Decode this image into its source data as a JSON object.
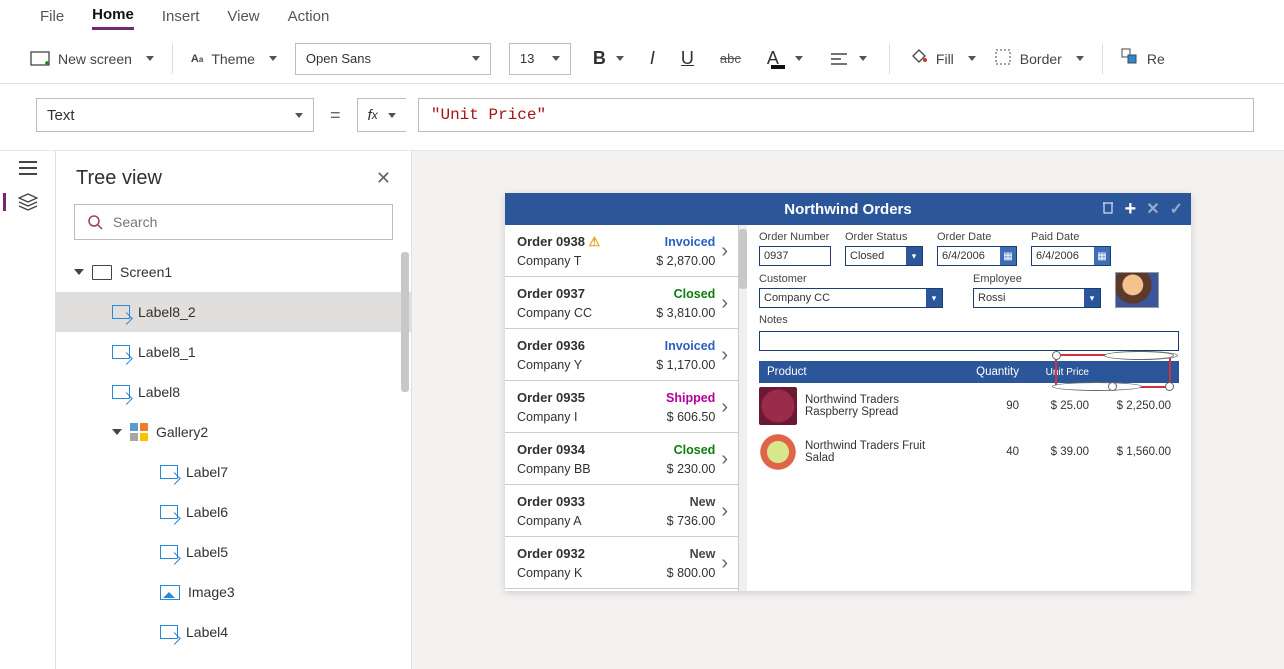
{
  "menu": {
    "file": "File",
    "home": "Home",
    "insert": "Insert",
    "view": "View",
    "action": "Action"
  },
  "ribbon": {
    "new_screen": "New screen",
    "theme": "Theme",
    "font": "Open Sans",
    "size": "13",
    "fill": "Fill",
    "border": "Border",
    "reorder": "Re"
  },
  "formula": {
    "property": "Text",
    "value": "\"Unit Price\""
  },
  "tree": {
    "title": "Tree view",
    "search_placeholder": "Search",
    "items": [
      {
        "type": "screen",
        "label": "Screen1"
      },
      {
        "type": "label",
        "label": "Label8_2",
        "selected": true
      },
      {
        "type": "label",
        "label": "Label8_1"
      },
      {
        "type": "label",
        "label": "Label8"
      },
      {
        "type": "gallery",
        "label": "Gallery2"
      },
      {
        "type": "label",
        "label": "Label7"
      },
      {
        "type": "label",
        "label": "Label6"
      },
      {
        "type": "label",
        "label": "Label5"
      },
      {
        "type": "image",
        "label": "Image3"
      },
      {
        "type": "label",
        "label": "Label4"
      }
    ]
  },
  "app": {
    "title": "Northwind Orders",
    "orders": [
      {
        "num": "Order 0938",
        "company": "Company T",
        "status": "Invoiced",
        "amount": "$ 2,870.00",
        "warn": true
      },
      {
        "num": "Order 0937",
        "company": "Company CC",
        "status": "Closed",
        "amount": "$ 3,810.00"
      },
      {
        "num": "Order 0936",
        "company": "Company Y",
        "status": "Invoiced",
        "amount": "$ 1,170.00"
      },
      {
        "num": "Order 0935",
        "company": "Company I",
        "status": "Shipped",
        "amount": "$ 606.50"
      },
      {
        "num": "Order 0934",
        "company": "Company BB",
        "status": "Closed",
        "amount": "$ 230.00"
      },
      {
        "num": "Order 0933",
        "company": "Company A",
        "status": "New",
        "amount": "$ 736.00"
      },
      {
        "num": "Order 0932",
        "company": "Company K",
        "status": "New",
        "amount": "$ 800.00"
      }
    ],
    "detail": {
      "labels": {
        "order_number": "Order Number",
        "order_status": "Order Status",
        "order_date": "Order Date",
        "paid_date": "Paid Date",
        "customer": "Customer",
        "employee": "Employee",
        "notes": "Notes"
      },
      "values": {
        "order_number": "0937",
        "order_status": "Closed",
        "order_date": "6/4/2006",
        "paid_date": "6/4/2006",
        "customer": "Company CC",
        "employee": "Rossi"
      },
      "grid_headers": {
        "product": "Product",
        "quantity": "Quantity",
        "unit_price": "Unit Price",
        "extended": ""
      },
      "grid_rows": [
        {
          "img": "berry",
          "name": "Northwind Traders Raspberry Spread",
          "qty": "90",
          "unit": "$ 25.00",
          "ext": "$ 2,250.00"
        },
        {
          "img": "salad",
          "name": "Northwind Traders Fruit Salad",
          "qty": "40",
          "unit": "$ 39.00",
          "ext": "$ 1,560.00"
        }
      ]
    }
  }
}
